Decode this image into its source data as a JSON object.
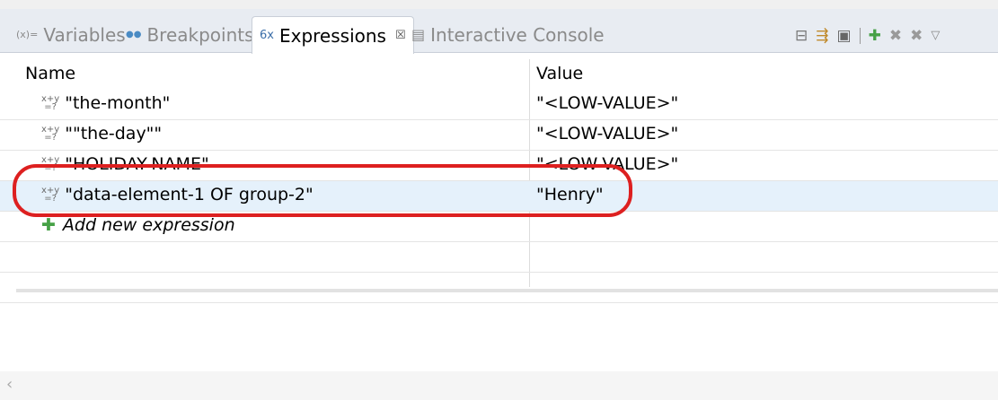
{
  "tabs": [
    {
      "icon": "(x)=",
      "label": "Variables"
    },
    {
      "icon": "●●",
      "label": "Breakpoints"
    },
    {
      "icon": "6x",
      "label": "Expressions",
      "close": "☒"
    },
    {
      "icon": "▤",
      "label": "Interactive Console"
    }
  ],
  "toolbar": [
    "collapse-all-icon",
    "show-type-names-icon",
    "show-logical-structure-icon",
    "add-expression-icon",
    "remove-icon",
    "remove-all-icon",
    "view-menu-icon"
  ],
  "columns": {
    "name": "Name",
    "value": "Value"
  },
  "expressions": [
    {
      "name": "\"the-month\"",
      "value": "\"<LOW-VALUE>\""
    },
    {
      "name": "\"\"the-day\"\"",
      "value": "\"<LOW-VALUE>\""
    },
    {
      "name": "\"HOLIDAY-NAME\"",
      "value": "\"<LOW-VALUE>\""
    },
    {
      "name": "\"data-element-1 OF group-2\"",
      "value": "\"Henry\""
    }
  ],
  "add_row": "Add new expression",
  "colors": {
    "highlight": "#dd2020",
    "selected_row": "#e5f1fb",
    "tabbar": "#e8ecf2"
  }
}
